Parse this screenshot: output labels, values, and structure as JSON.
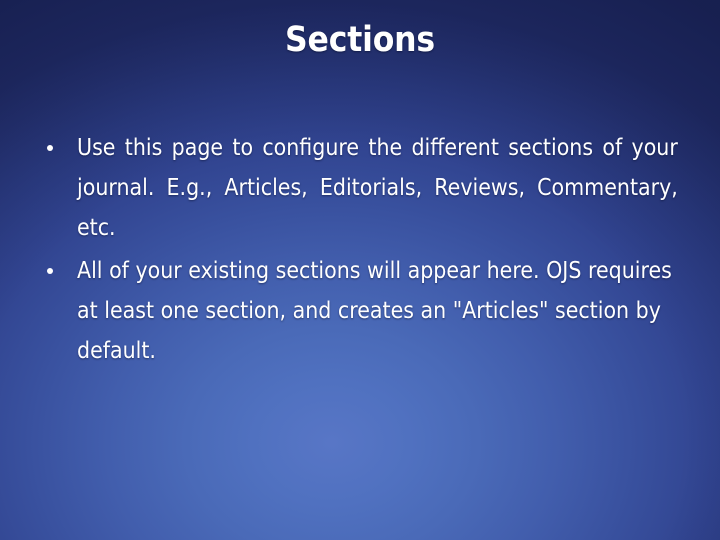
{
  "slide": {
    "title": "Sections",
    "background": {
      "center_color": "#5876c6",
      "edge_color": "#212c68"
    },
    "text_color": "#ffffff",
    "bullets": [
      {
        "marker": "bullet-dot",
        "alignment": "justify",
        "text": "Use this page to configure the different sections of your journal. E.g., Articles, Editorials, Reviews, Commentary, etc.",
        "lines": [
          "Use this page to configure the different",
          "sections of your journal. E.g., Articles,",
          "Editorials, Reviews, Commentary, etc."
        ]
      },
      {
        "marker": "bullet-dot",
        "alignment": "left",
        "text": "All of your existing sections will appear here. OJS requires at least one section, and creates an \"Articles\" section by default.",
        "lines": [
          "All of your existing sections will appear here.",
          "OJS requires at least one section, and creates",
          "an \"Articles\" section by default."
        ]
      }
    ]
  }
}
